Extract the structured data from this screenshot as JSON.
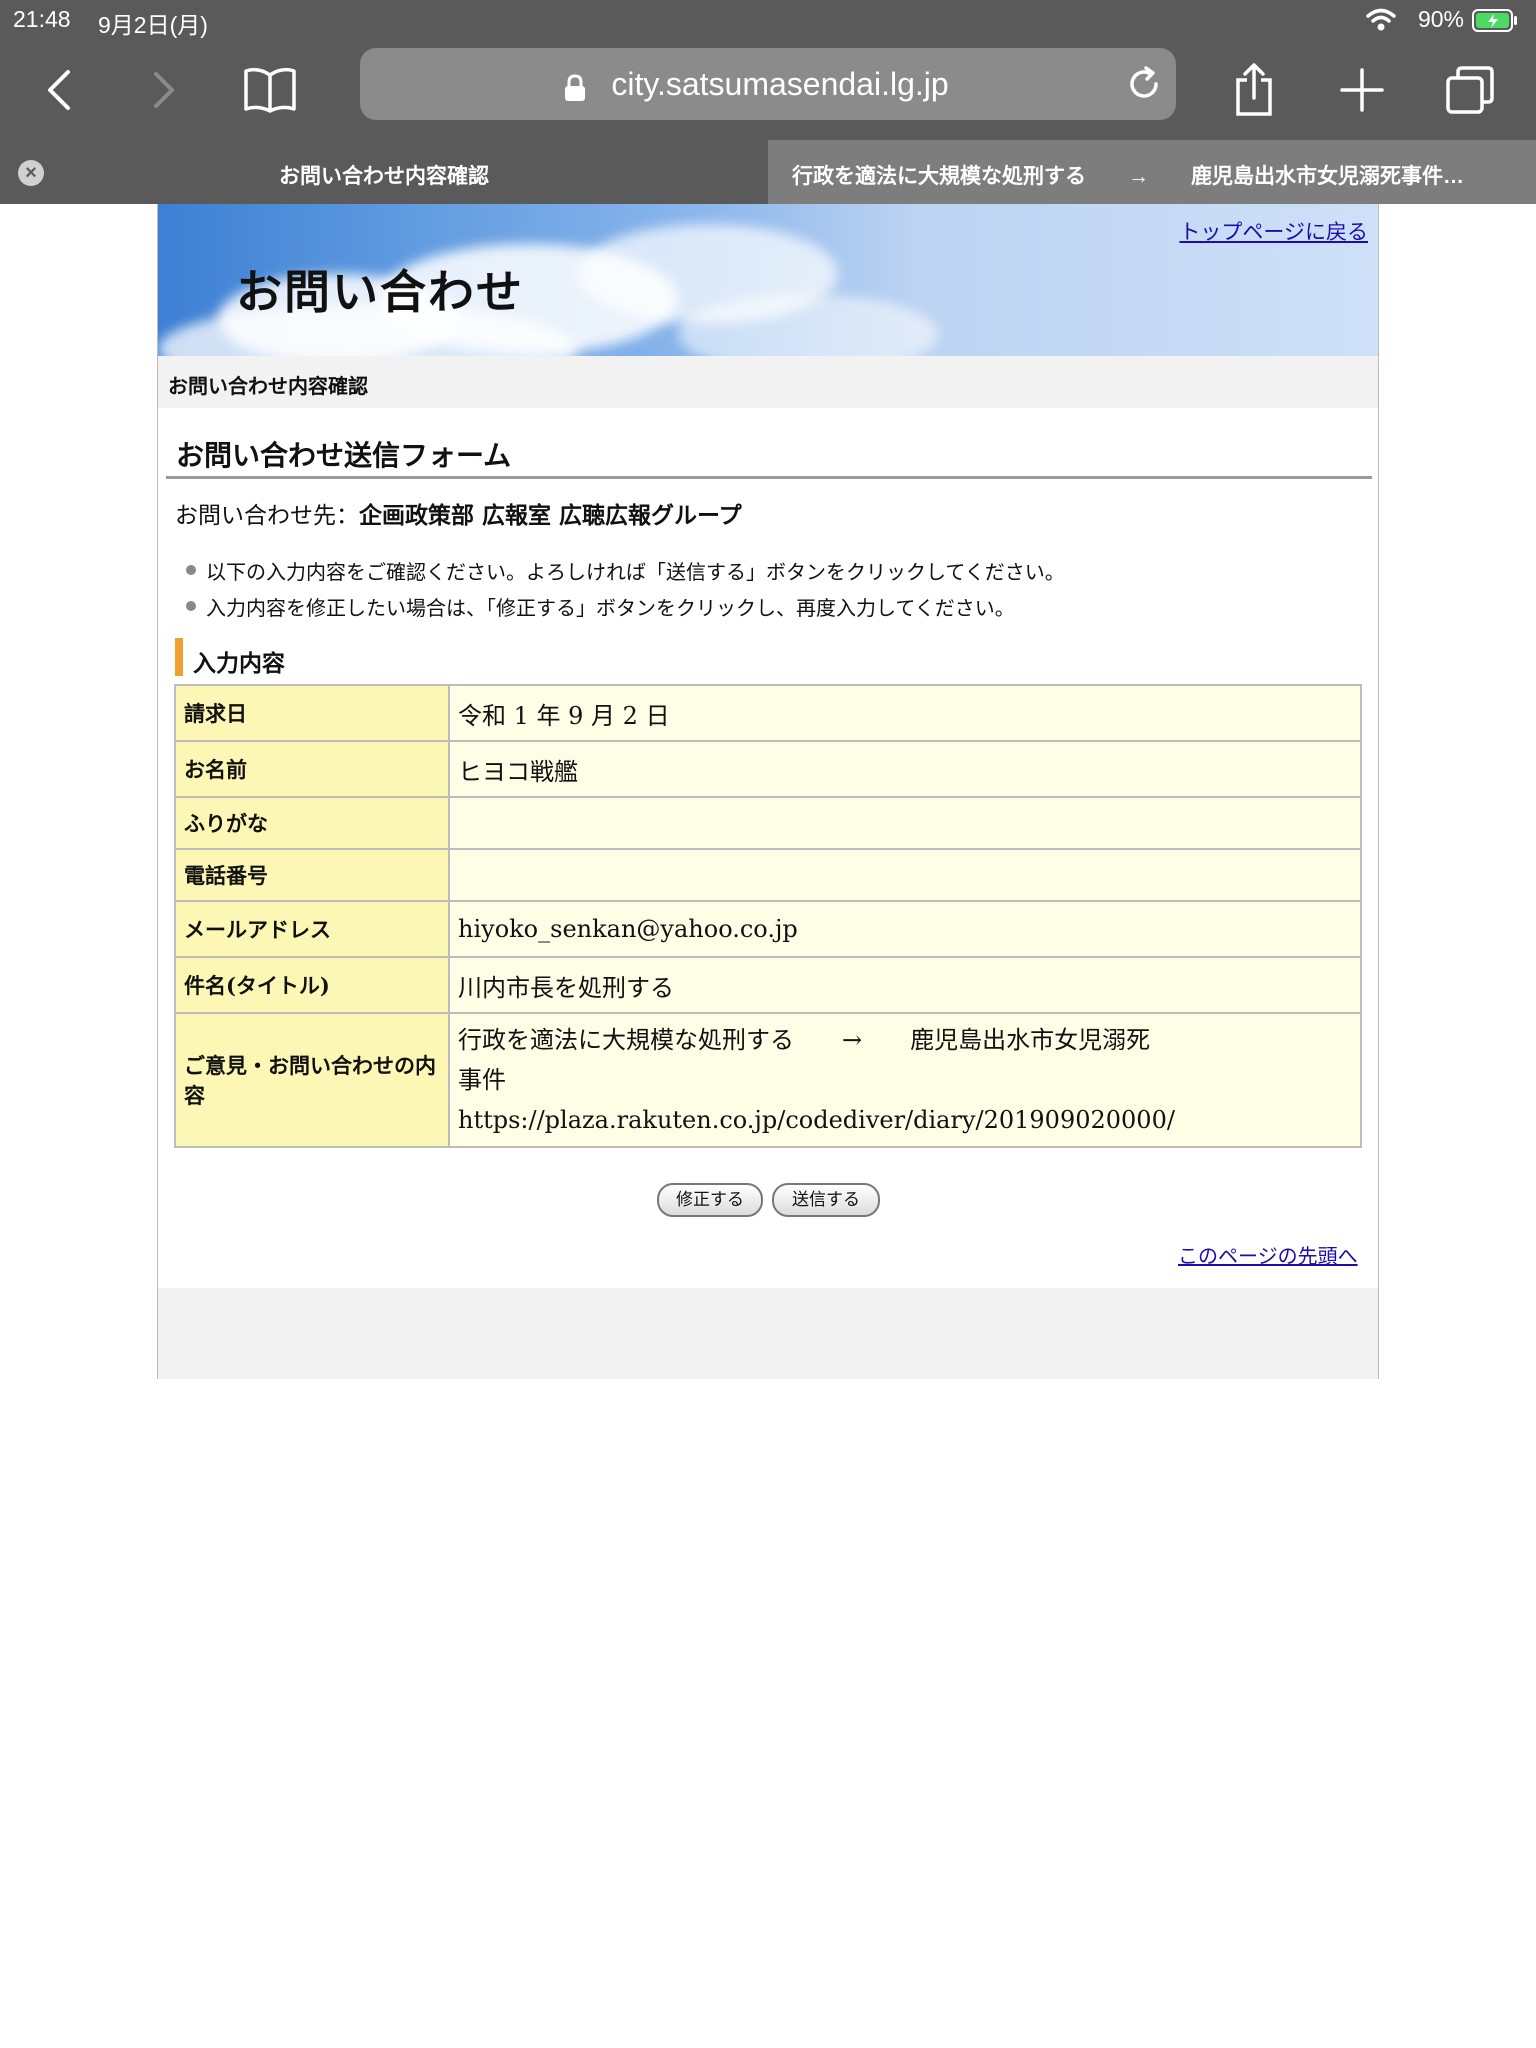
{
  "status_bar": {
    "time": "21:48",
    "date": "9月2日(月)",
    "battery": "90%"
  },
  "browser": {
    "url": "city.satsumasendai.lg.jp",
    "tabs": [
      {
        "label": "お問い合わせ内容確認",
        "active": true
      },
      {
        "label": "行政を適法に大規模な処刑する　　→　　鹿児島出水市女児溺死事件…",
        "active": false
      }
    ],
    "icons": [
      "back-icon",
      "forward-icon",
      "bookmarks-icon",
      "lock-icon",
      "reload-icon",
      "share-icon",
      "new-tab-icon",
      "tabs-icon",
      "tab-close-icon"
    ]
  },
  "header": {
    "banner_title": "お問い合わせ",
    "top_link": "トップページに戻る",
    "breadcrumb": "お問い合わせ内容確認"
  },
  "form": {
    "title": "お問い合わせ送信フォーム",
    "contact_prefix": "お問い合わせ先：",
    "contact_dept": "企画政策部 広報室 広聴広報グループ",
    "notes": [
      "以下の入力内容をご確認ください。よろしければ「送信する」ボタンをクリックしてください。",
      "入力内容を修正したい場合は、「修正する」ボタンをクリックし、再度入力してください。"
    ],
    "section_title": "入力内容",
    "rows": [
      {
        "label": "請求日",
        "value": "令和 1 年 9 月 2 日"
      },
      {
        "label": "お名前",
        "value": "ヒヨコ戦艦"
      },
      {
        "label": "ふりがな",
        "value": ""
      },
      {
        "label": "電話番号",
        "value": ""
      },
      {
        "label": "メールアドレス",
        "value": "hiyoko_senkan@yahoo.co.jp"
      },
      {
        "label": "件名(タイトル)",
        "value": "川内市長を処刑する"
      },
      {
        "label": "ご意見・お問い合わせの内容",
        "value_lines": [
          "行政を適法に大規模な処刑する　　→　　鹿児島出水市女児溺死",
          "事件",
          "https://plaza.rakuten.co.jp/codediver/diary/201909020000/"
        ]
      }
    ],
    "buttons": {
      "edit": "修正する",
      "send": "送信する"
    },
    "page_top_link": "このページの先頭へ"
  },
  "colors": {
    "chrome": "#5a5a5a",
    "label_cell": "#fdf7b6",
    "value_cell": "#fefde6",
    "section_accent": "#f0a030",
    "link": "#1a0dab"
  }
}
